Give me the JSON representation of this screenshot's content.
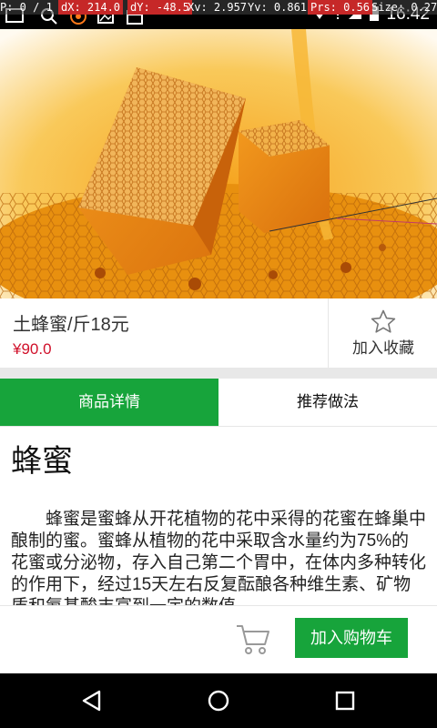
{
  "status_bar": {
    "debug": {
      "pointer": "P: 0 / 1",
      "dx": "dX: 214.0",
      "dy": "dY: -48.5",
      "xv": "Xv: 2.957",
      "yv": "Yv: 0.861",
      "prs": "Prs: 0.56",
      "size": "Size: 0.27"
    },
    "time": "16:42",
    "notification_icons": [
      "notification-badge-icon",
      "search-icon",
      "app-icon",
      "image-icon",
      "calendar-icon"
    ],
    "system_icons": [
      "wifi-icon",
      "alert-icon",
      "signal-icon",
      "battery-icon"
    ]
  },
  "product": {
    "title": "土蜂蜜/斤18元",
    "price": "¥90.0",
    "favorite_label": "加入收藏",
    "hero_icon": "honeycomb-photo"
  },
  "tabs": [
    {
      "label": "商品详情",
      "active": true
    },
    {
      "label": "推荐做法",
      "active": false
    }
  ],
  "detail": {
    "heading": "蜂蜜",
    "paragraph": "蜂蜜是蜜蜂从开花植物的花中采得的花蜜在蜂巢中酿制的蜜。蜜蜂从植物的花中采取含水量约为75%的花蜜或分泌物，存入自己第二个胃中，在体内多种转化的作用下，经过15天左右反复酝酿各种维生素、矿物质和氨基酸丰富到一定的数值"
  },
  "bottom_bar": {
    "cart_icon": "cart-icon",
    "add_to_cart_label": "加入购物车"
  },
  "colors": {
    "accent_green": "#17a43b",
    "price_red": "#d0102a"
  },
  "nav_bar": [
    "back-icon",
    "home-icon",
    "recents-icon"
  ]
}
